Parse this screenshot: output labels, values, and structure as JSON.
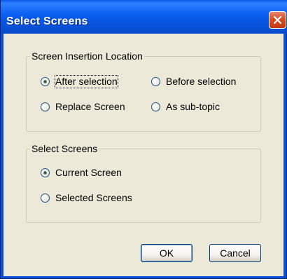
{
  "window": {
    "title": "Select Screens",
    "title_bar_color": "#0a5ef0",
    "client_color": "#ece9d8",
    "close_icon": "close-icon",
    "close_button_color": "#d9491e"
  },
  "insertion_group": {
    "legend": "Screen Insertion Location",
    "options": [
      {
        "label": "After selection",
        "checked": true
      },
      {
        "label": "Before selection",
        "checked": false
      },
      {
        "label": "Replace Screen",
        "checked": false
      },
      {
        "label": "As sub-topic",
        "checked": false
      }
    ]
  },
  "select_group": {
    "legend": "Select Screens",
    "options": [
      {
        "label": "Current Screen",
        "checked": true
      },
      {
        "label": "Selected Screens",
        "checked": false
      }
    ]
  },
  "buttons": {
    "ok_label": "OK",
    "cancel_label": "Cancel"
  }
}
